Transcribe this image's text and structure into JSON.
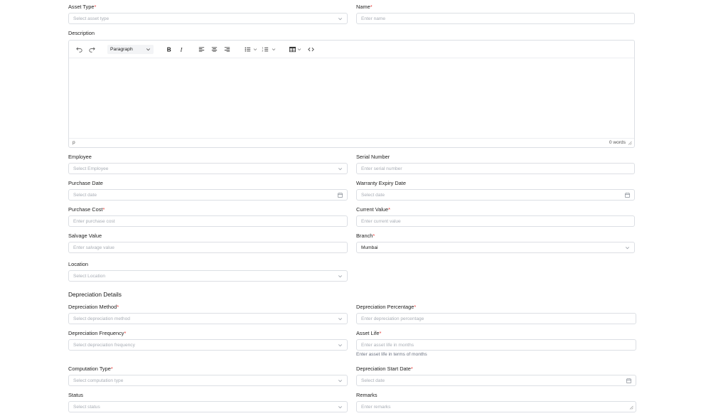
{
  "form": {
    "asset_type": {
      "label": "Asset Type",
      "required": "*",
      "placeholder": "Select asset type"
    },
    "name": {
      "label": "Name",
      "required": "*",
      "placeholder": "Enter name"
    },
    "description": {
      "label": "Description"
    },
    "editor": {
      "block_format": "Paragraph",
      "path": "p",
      "word_count": "0 words"
    },
    "employee": {
      "label": "Employee",
      "placeholder": "Select Employee"
    },
    "serial_number": {
      "label": "Serial Number",
      "placeholder": "Enter serial number"
    },
    "purchase_date": {
      "label": "Purchase Date",
      "placeholder": "Select date"
    },
    "warranty_expiry_date": {
      "label": "Warranty Expiry Date",
      "placeholder": "Select date"
    },
    "purchase_cost": {
      "label": "Purchase Cost",
      "required": "*",
      "placeholder": "Enter purchase cost"
    },
    "current_value": {
      "label": "Current Value",
      "required": "*",
      "placeholder": "Enter current value"
    },
    "salvage_value": {
      "label": "Salvage Value",
      "placeholder": "Enter salvage value"
    },
    "branch": {
      "label": "Branch",
      "required": "*",
      "value": "Mumbai"
    },
    "location": {
      "label": "Location",
      "placeholder": "Select Location"
    }
  },
  "depreciation": {
    "title": "Depreciation Details",
    "method": {
      "label": "Depreciation Method",
      "required": "*",
      "placeholder": "Select depreciation method"
    },
    "percentage": {
      "label": "Depreciation Percentage",
      "required": "*",
      "placeholder": "Enter depreciation percentage"
    },
    "frequency": {
      "label": "Depreciation Frequency",
      "required": "*",
      "placeholder": "Select depreciation frequency"
    },
    "asset_life": {
      "label": "Asset Life",
      "required": "*",
      "placeholder": "Enter asset life in months",
      "hint": "Enter asset life in terms of months"
    },
    "computation_type": {
      "label": "Computation Type",
      "required": "*",
      "placeholder": "Select computation type"
    },
    "start_date": {
      "label": "Depreciation Start Date",
      "required": "*",
      "placeholder": "Select date"
    },
    "status": {
      "label": "Status",
      "placeholder": "Select status"
    },
    "remarks": {
      "label": "Remarks",
      "placeholder": "Enter remarks"
    }
  },
  "icons": {
    "chevron": "chevron-down-icon",
    "calendar": "calendar-icon",
    "toolbar": [
      "undo-icon",
      "redo-icon",
      "bold-icon",
      "italic-icon",
      "align-left-icon",
      "align-center-icon",
      "align-right-icon",
      "bullet-list-icon",
      "numbered-list-icon",
      "table-icon",
      "code-icon"
    ]
  },
  "colors": {
    "required": "#e53935",
    "border": "#dcdfe4",
    "placeholder": "#a8adb5"
  }
}
